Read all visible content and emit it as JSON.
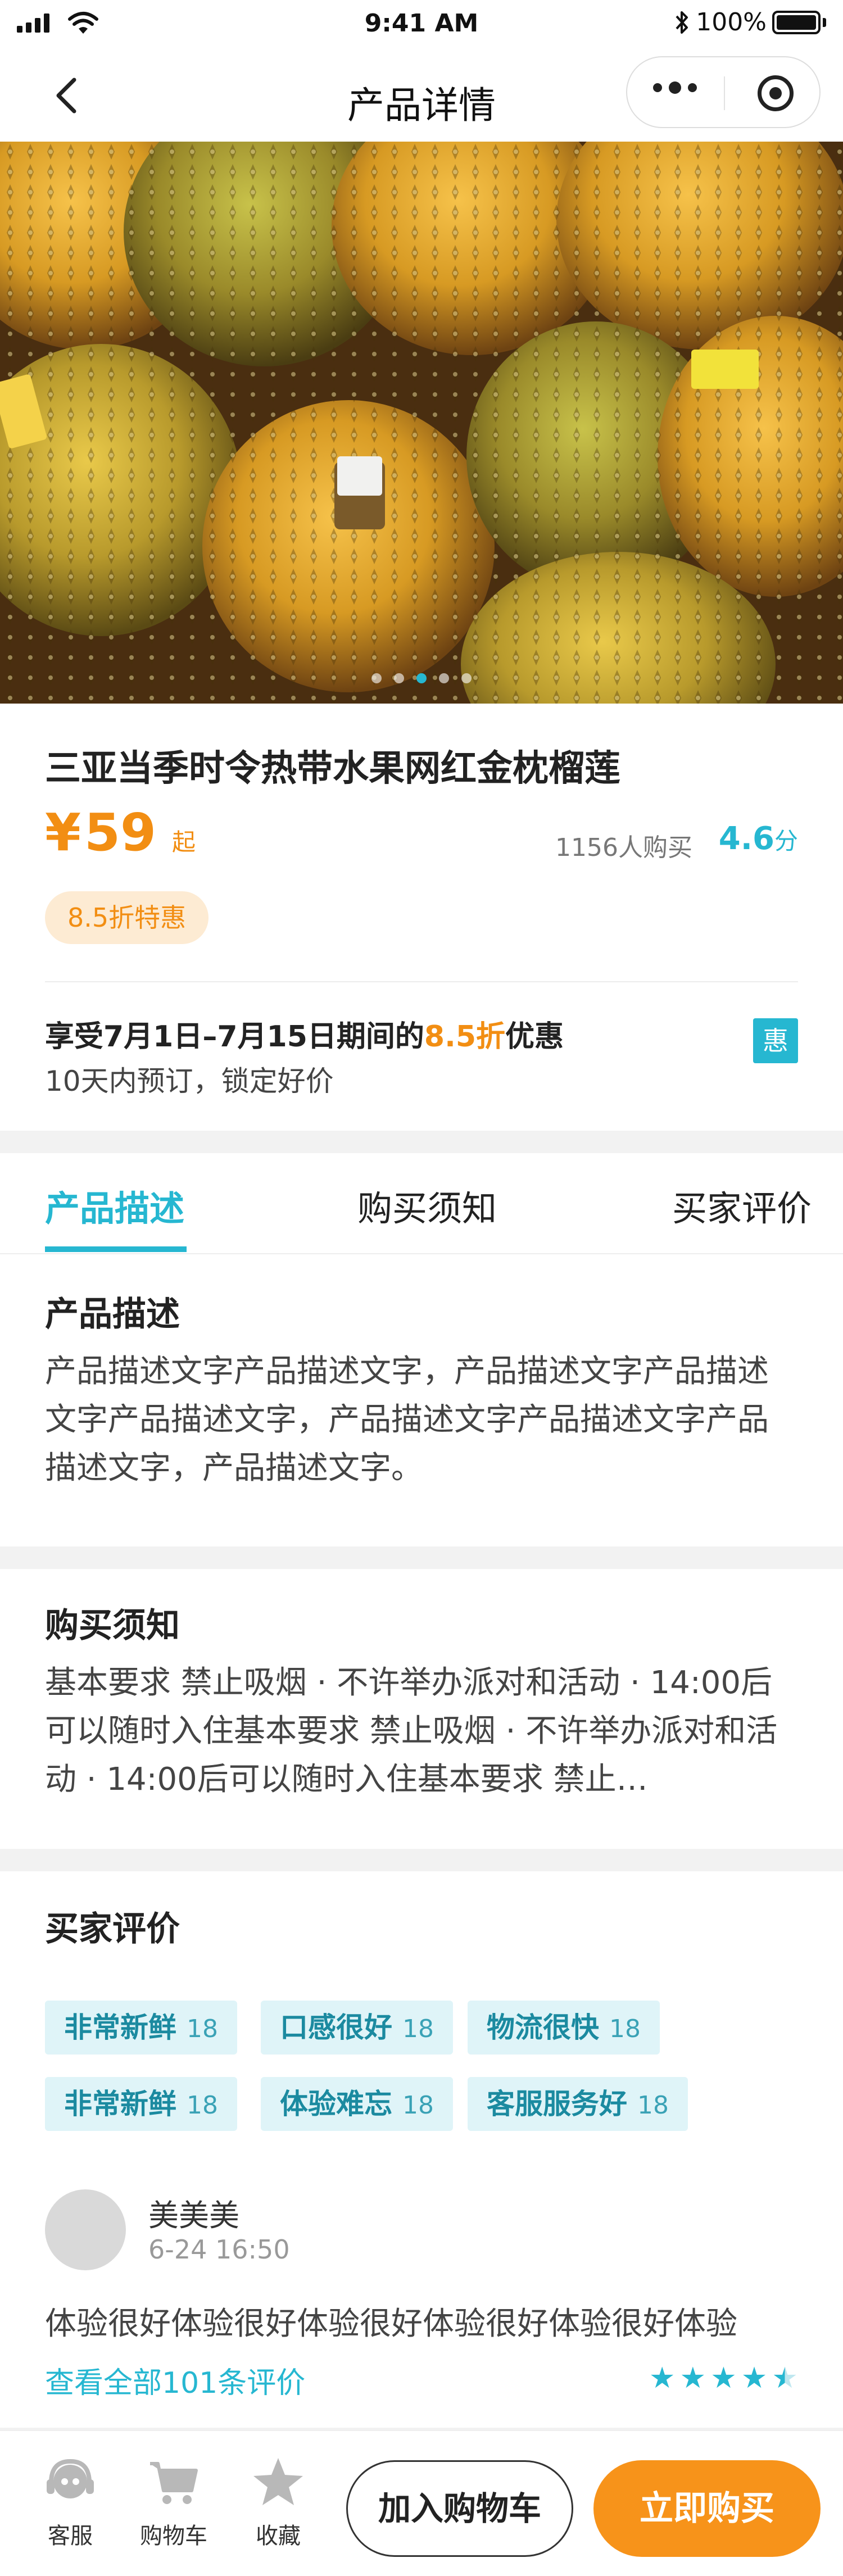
{
  "status_bar": {
    "time": "9:41 AM",
    "battery": "100%"
  },
  "nav": {
    "title": "产品详情"
  },
  "carousel": {
    "slide_count": 5,
    "active_index": 2
  },
  "product": {
    "title": "三亚当季时令热带水果网红金枕榴莲",
    "currency": "¥",
    "price": "59",
    "price_suffix": "起",
    "sold": "1156人购买",
    "score": "4.6",
    "score_unit": "分",
    "discount_badge": "8.5折特惠",
    "promo_prefix": "享受7月1日–7月15日期间的",
    "promo_highlight": "8.5折",
    "promo_suffix": "优惠",
    "promo_sub": "10天内预订，锁定好价",
    "promo_icon": "惠"
  },
  "tabs": [
    {
      "label": "产品描述",
      "active": true
    },
    {
      "label": "购买须知",
      "active": false
    },
    {
      "label": "买家评价",
      "active": false
    }
  ],
  "description": {
    "title": "产品描述",
    "text": "产品描述文字产品描述文字，产品描述文字产品描述文字产品描述文字，产品描述文字产品描述文字产品描述文字，产品描述文字。"
  },
  "notice": {
    "title": "购买须知",
    "text": "基本要求 禁止吸烟 · 不许举办派对和活动 · 14:00后可以随时入住基本要求 禁止吸烟 · 不许举办派对和活动 · 14:00后可以随时入住基本要求 禁止…"
  },
  "reviews": {
    "title": "买家评价",
    "tags": [
      {
        "label": "非常新鲜",
        "count": "18"
      },
      {
        "label": "口感很好",
        "count": "18"
      },
      {
        "label": "物流很快",
        "count": "18"
      },
      {
        "label": "非常新鲜",
        "count": "18"
      },
      {
        "label": "体验难忘",
        "count": "18"
      },
      {
        "label": "客服服务好",
        "count": "18"
      }
    ],
    "first": {
      "user": "美美美",
      "date": "6-24 16:50",
      "text": "体验很好体验很好体验很好体验很好体验很好体验",
      "rating": 4.5
    },
    "view_all": "查看全部101条评价"
  },
  "bottom_bar": {
    "service": "客服",
    "cart": "购物车",
    "favorite": "收藏",
    "add_to_cart": "加入购物车",
    "buy_now": "立即购买"
  },
  "colors": {
    "accent": "#26b7d1",
    "price": "#f28e13",
    "buy": "#f7931a"
  }
}
